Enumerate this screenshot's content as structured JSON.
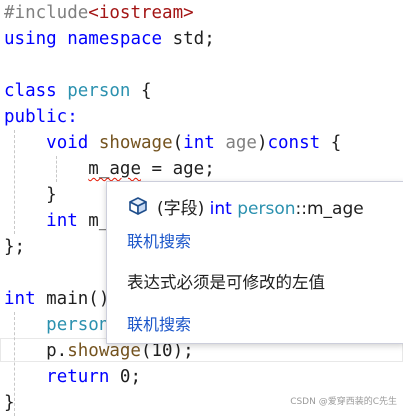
{
  "code": {
    "lines": [
      [
        {
          "t": "#include",
          "c": "inc"
        },
        {
          "t": "<iostream>",
          "c": "incs"
        }
      ],
      [
        {
          "t": "using",
          "c": "kw"
        },
        {
          "t": " ",
          "c": "plain"
        },
        {
          "t": "namespace",
          "c": "kw"
        },
        {
          "t": " std;",
          "c": "plain"
        }
      ],
      [],
      [
        {
          "t": "class",
          "c": "kw"
        },
        {
          "t": " ",
          "c": "plain"
        },
        {
          "t": "person",
          "c": "type"
        },
        {
          "t": " {",
          "c": "plain"
        }
      ],
      [
        {
          "t": "public:",
          "c": "kw"
        }
      ],
      [
        {
          "t": "    ",
          "c": "plain"
        },
        {
          "t": "void",
          "c": "kw"
        },
        {
          "t": " ",
          "c": "plain"
        },
        {
          "t": "showage",
          "c": "fn"
        },
        {
          "t": "(",
          "c": "plain"
        },
        {
          "t": "int",
          "c": "kw"
        },
        {
          "t": " ",
          "c": "plain"
        },
        {
          "t": "age",
          "c": "param"
        },
        {
          "t": ")",
          "c": "plain"
        },
        {
          "t": "const",
          "c": "kw"
        },
        {
          "t": " {",
          "c": "plain"
        }
      ],
      [
        {
          "t": "        ",
          "c": "plain"
        },
        {
          "t": "m_age",
          "c": "plain squiggle"
        },
        {
          "t": " = age;",
          "c": "plain"
        }
      ],
      [
        {
          "t": "    }",
          "c": "plain"
        }
      ],
      [
        {
          "t": "    ",
          "c": "plain"
        },
        {
          "t": "int",
          "c": "kw"
        },
        {
          "t": " m_",
          "c": "plain"
        }
      ],
      [
        {
          "t": "};",
          "c": "plain"
        }
      ],
      [],
      [
        {
          "t": "int",
          "c": "kw"
        },
        {
          "t": " main()",
          "c": "plain"
        }
      ],
      [
        {
          "t": "    ",
          "c": "plain"
        },
        {
          "t": "person",
          "c": "type"
        }
      ],
      [
        {
          "t": "    p.",
          "c": "plain"
        },
        {
          "t": "showage",
          "c": "fn"
        },
        {
          "t": "(10);",
          "c": "plain"
        }
      ],
      [
        {
          "t": "    ",
          "c": "plain"
        },
        {
          "t": "return",
          "c": "kw"
        },
        {
          "t": " 0;",
          "c": "plain"
        }
      ],
      [
        {
          "t": "}",
          "c": "plain"
        }
      ]
    ]
  },
  "quickinfo": {
    "kind": "(字段)",
    "type": "int",
    "class_name": "person",
    "scope_sep": "::",
    "member": "m_age",
    "online_search_1": "联机搜索",
    "error_message": "表达式必须是可修改的左值",
    "online_search_2": "联机搜索",
    "icon": "field-icon"
  },
  "watermark": "CSDN @爱穿西装的C先生",
  "colors": {
    "keyword": "#0000ff",
    "type": "#2b91af",
    "function": "#74531f",
    "param": "#808080",
    "link": "#1a55c9",
    "squiggle": "#e51400"
  }
}
